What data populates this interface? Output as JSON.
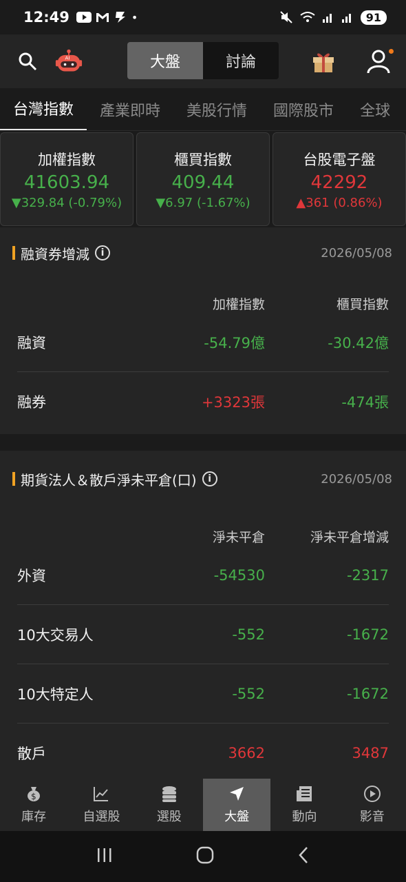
{
  "status_bar": {
    "time": "12:49",
    "battery": "91"
  },
  "top_nav": {
    "segments": [
      "大盤",
      "討論"
    ],
    "active_segment": "大盤"
  },
  "tabs": [
    "台灣指數",
    "產業即時",
    "美股行情",
    "國際股市",
    "全球"
  ],
  "indices": [
    {
      "name": "加權指數",
      "value": "41603.94",
      "change": "▼329.84 (-0.79%)",
      "color": "green"
    },
    {
      "name": "櫃買指數",
      "value": "409.44",
      "change": "▼6.97 (-1.67%)",
      "color": "green"
    },
    {
      "name": "台股電子盤",
      "value": "42292",
      "change": "▲361 (0.86%)",
      "color": "red"
    }
  ],
  "margin": {
    "title": "融資券增減",
    "date": "2026/05/08",
    "columns": [
      "加權指數",
      "櫃買指數"
    ],
    "rows": [
      {
        "label": "融資",
        "v1": "-54.79億",
        "v2": "-30.42億"
      },
      {
        "label": "融券",
        "v1": "+3323張",
        "v2": "-474張"
      }
    ]
  },
  "futures": {
    "title": "期貨法人＆散戶淨未平倉(口)",
    "date": "2026/05/08",
    "columns": [
      "淨未平倉",
      "淨未平倉增減"
    ],
    "rows": [
      {
        "label": "外資",
        "v1": "-54530",
        "v2": "-2317"
      },
      {
        "label": "10大交易人",
        "v1": "-552",
        "v2": "-1672"
      },
      {
        "label": "10大特定人",
        "v1": "-552",
        "v2": "-1672"
      },
      {
        "label": "散戶",
        "v1": "3662",
        "v2": "3487"
      }
    ]
  },
  "bottom_nav": [
    {
      "label": "庫存",
      "icon": "money-bag-icon"
    },
    {
      "label": "自選股",
      "icon": "chart-line-icon"
    },
    {
      "label": "選股",
      "icon": "coin-stack-icon"
    },
    {
      "label": "大盤",
      "icon": "navigation-arrow-icon"
    },
    {
      "label": "動向",
      "icon": "news-icon"
    },
    {
      "label": "影音",
      "icon": "play-icon"
    }
  ],
  "colors": {
    "up": "#e0373a",
    "down": "#47b04b",
    "accent": "#f0a223"
  }
}
